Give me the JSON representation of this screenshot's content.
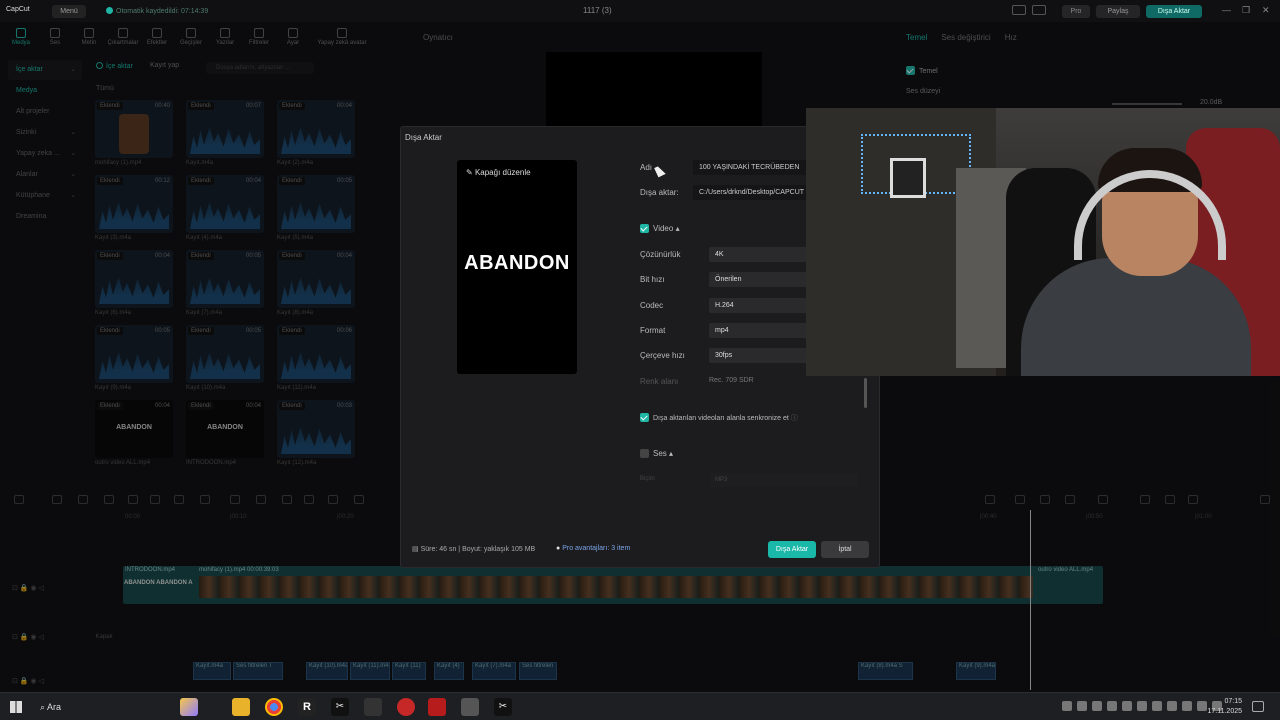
{
  "titlebar": {
    "logo": "CapCut",
    "menu": "Menü",
    "autosave": "Otomatik kaydedildi: 07:14:39",
    "project_title": "1117 (3)",
    "pro": "Pro",
    "share": "Paylaş",
    "export": "Dışa Aktar"
  },
  "tools": [
    {
      "label": "Medya",
      "icon": "media-icon",
      "active": true
    },
    {
      "label": "Ses",
      "icon": "audio-icon"
    },
    {
      "label": "Metin",
      "icon": "text-icon"
    },
    {
      "label": "Çıkartmalar",
      "icon": "sticker-icon"
    },
    {
      "label": "Efektler",
      "icon": "effects-icon"
    },
    {
      "label": "Geçişler",
      "icon": "transition-icon"
    },
    {
      "label": "Yazılar",
      "icon": "captions-icon"
    },
    {
      "label": "Filtreler",
      "icon": "filter-icon"
    },
    {
      "label": "Ayar",
      "icon": "adjust-icon"
    },
    {
      "label": "Yapay zekâ avatar",
      "icon": "ai-avatar-icon"
    }
  ],
  "sidenav": [
    {
      "label": "İçe aktar",
      "sel": true
    },
    {
      "label": "Medya",
      "hl": true
    },
    {
      "label": "Alt projeler"
    },
    {
      "label": "Sizinki"
    },
    {
      "label": "Yapay zeka ..."
    },
    {
      "label": "Alanlar"
    },
    {
      "label": "Kütüphane"
    },
    {
      "label": "Dreamina"
    }
  ],
  "media": {
    "import": "İçe aktar",
    "record": "Kayıt yap",
    "search_placeholder": "Dosya adlarını, altyazıları ...",
    "all": "Tümü",
    "badge": "Eklendi",
    "clips": [
      {
        "name": "mohifacy (1).mp4",
        "dur": "00:40",
        "kind": "face"
      },
      {
        "name": "Kayıt.m4a",
        "dur": "00:07"
      },
      {
        "name": "Kayıt (2).m4a",
        "dur": "00:04"
      },
      {
        "name": "Kayıt (3).m4a",
        "dur": "00:12"
      },
      {
        "name": "Kayıt (4).m4a",
        "dur": "00:04"
      },
      {
        "name": "Kayıt (5).m4a",
        "dur": "00:05"
      },
      {
        "name": "Kayıt (6).m4a",
        "dur": "00:04"
      },
      {
        "name": "Kayıt (7).m4a",
        "dur": "00:05"
      },
      {
        "name": "Kayıt (8).m4a",
        "dur": "00:04"
      },
      {
        "name": "Kayıt (9).m4a",
        "dur": "00:05"
      },
      {
        "name": "Kayıt (10).m4a",
        "dur": "00:05"
      },
      {
        "name": "Kayıt (11).m4a",
        "dur": "00:06"
      },
      {
        "name": "outro video ALL.mp4",
        "dur": "00:04",
        "kind": "dark",
        "text": "ABANDON"
      },
      {
        "name": "INTRODOON.mp4",
        "dur": "00:04",
        "kind": "dark",
        "text": "ABANDON"
      },
      {
        "name": "Kayıt (12).m4a",
        "dur": "00:03"
      }
    ]
  },
  "player": {
    "label": "Oynatıcı"
  },
  "right_panel": {
    "tabs": [
      "Temel",
      "Ses değiştirici",
      "Hız"
    ],
    "section": "Temel",
    "volume_label": "Ses düzeyi",
    "volume_value": "20.0dB"
  },
  "modal": {
    "title": "Dışa Aktar",
    "cover_edit": "Kapağı düzenle",
    "cover_text": "ABANDON",
    "name_label": "Adı",
    "name_value": "100 YAŞINDAKİ TECRÜBEDEN",
    "path_label": "Dışa aktar:",
    "path_value": "C:/Users/drknd/Desktop/CAPCUT",
    "video_section": "Video",
    "fields": [
      {
        "label": "Çözünürlük",
        "value": "4K"
      },
      {
        "label": "Bit hızı",
        "value": "Önerilen"
      },
      {
        "label": "Codec",
        "value": "H.264"
      },
      {
        "label": "Format",
        "value": "mp4"
      },
      {
        "label": "Çerçeve hızı",
        "value": "30fps"
      }
    ],
    "color_label": "Renk alanı",
    "color_value": "Rec. 709 SDR",
    "sync_label": "Dışa aktarılan videoları alanla senkronize et",
    "audio_section": "Ses",
    "audio_format_label": "Biçim",
    "audio_format_value": "MP3",
    "footer_info": "Süre: 46 sn | Boyut: yaklaşık 105 MB",
    "pro_adv": "Pro avantajları: 3 item",
    "export_btn": "Dışa Aktar",
    "cancel_btn": "İptal"
  },
  "timeline": {
    "ruler": [
      "00:00",
      "|00:10",
      "|00:20",
      "|00:30",
      "|00:40",
      "|00:50",
      "|01:00"
    ],
    "main_track_label": "INTRODOON.mp4",
    "main_track_label2": "mohifacy (1).mp4  00:00:39:03",
    "main_track_label3": "outro video ALL.mp4",
    "main_track_text": "ABANDON ABANDON A",
    "cover_label": "Kapak",
    "audio_clips": [
      "Kayıt.m4a",
      "Ses filtreleri  T",
      "Kayıt (10).m4a",
      "Kayıt (11).m4a",
      "Kayıt (11)",
      "Kayıt (4)",
      "Kayıt (7).m4a",
      "Ses filtreleri",
      "Kayıt (8).m4a  S",
      "Kayıt (9).m4a"
    ]
  },
  "taskbar": {
    "search": "Ara",
    "time": "07:15",
    "date": "17.11.2025"
  }
}
